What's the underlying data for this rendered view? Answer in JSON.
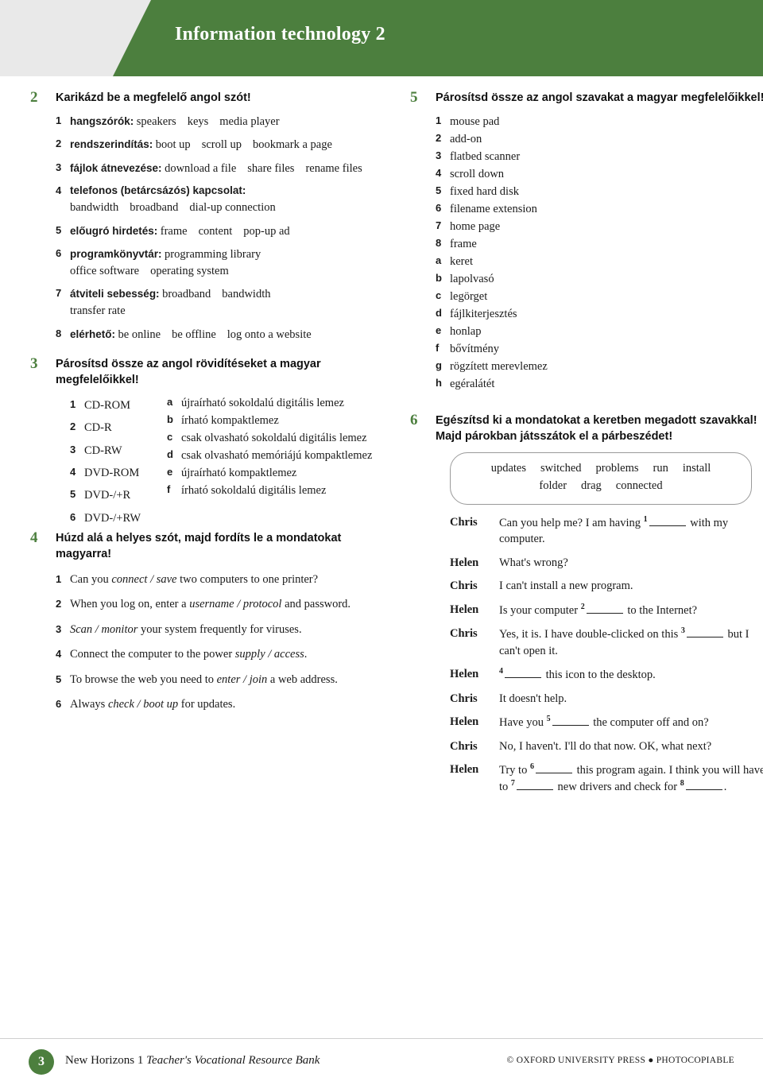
{
  "header": {
    "title": "Information technology 2"
  },
  "ex2": {
    "num": "2",
    "title": "Karikázd be a megfelelő angol szót!",
    "items": [
      {
        "n": "1",
        "lead": "hangszórók:",
        "options": [
          "speakers",
          "keys",
          "media player"
        ]
      },
      {
        "n": "2",
        "lead": "rendszerindítás:",
        "options": [
          "boot up",
          "scroll up",
          "bookmark a page"
        ]
      },
      {
        "n": "3",
        "lead": "fájlok átnevezése:",
        "options": [
          "download a file",
          "share files",
          "rename files"
        ]
      },
      {
        "n": "4",
        "lead": "telefonos (betárcsázós) kapcsolat:",
        "options": [
          "bandwidth",
          "broadband",
          "dial-up connection"
        ]
      },
      {
        "n": "5",
        "lead": "előugró hirdetés:",
        "options": [
          "frame",
          "content",
          "pop-up ad"
        ]
      },
      {
        "n": "6",
        "lead": "programkönyvtár:",
        "options": [
          "programming library",
          "office software",
          "operating system"
        ]
      },
      {
        "n": "7",
        "lead": "átviteli sebesség:",
        "options": [
          "broadband",
          "bandwidth",
          "transfer rate"
        ]
      },
      {
        "n": "8",
        "lead": "elérhető:",
        "options": [
          "be online",
          "be offline",
          "log onto a website"
        ]
      }
    ]
  },
  "ex3": {
    "num": "3",
    "title": "Párosítsd össze az angol rövidítéseket a magyar megfelelőikkel!",
    "left": [
      {
        "k": "1",
        "t": "CD-ROM"
      },
      {
        "k": "2",
        "t": "CD-R"
      },
      {
        "k": "3",
        "t": "CD-RW"
      },
      {
        "k": "4",
        "t": "DVD-ROM"
      },
      {
        "k": "5",
        "t": "DVD-/+R"
      },
      {
        "k": "6",
        "t": "DVD-/+RW"
      }
    ],
    "right": [
      {
        "k": "a",
        "t": "újraírható sokoldalú digitális lemez"
      },
      {
        "k": "b",
        "t": "írható kompaktlemez"
      },
      {
        "k": "c",
        "t": "csak olvasható sokoldalú digitális lemez"
      },
      {
        "k": "d",
        "t": "csak olvasható memóriájú kompaktlemez"
      },
      {
        "k": "e",
        "t": "újraírható kompaktlemez"
      },
      {
        "k": "f",
        "t": "írható sokoldalú digitális lemez"
      }
    ]
  },
  "ex4": {
    "num": "4",
    "title": "Húzd alá a helyes szót, majd fordíts le a mondatokat magyarra!",
    "sentences": [
      {
        "n": "1",
        "pre": "Can you ",
        "it": "connect / save",
        "post": " two computers to one printer?"
      },
      {
        "n": "2",
        "pre": "When you log on, enter a ",
        "it": "username / protocol",
        "post": " and password."
      },
      {
        "n": "3",
        "pre": "",
        "it": "Scan / monitor",
        "post": " your system frequently for viruses."
      },
      {
        "n": "4",
        "pre": "Connect the computer to the power ",
        "it": "supply / access",
        "post": "."
      },
      {
        "n": "5",
        "pre": "To browse the web you need to ",
        "it": "enter / join",
        "post": " a web address."
      },
      {
        "n": "6",
        "pre": "Always ",
        "it": "check / boot up",
        "post": " for updates."
      }
    ]
  },
  "ex5": {
    "num": "5",
    "title": "Párosítsd össze az angol szavakat a magyar megfelelőikkel!",
    "left": [
      {
        "k": "1",
        "t": "mouse pad"
      },
      {
        "k": "2",
        "t": "add-on"
      },
      {
        "k": "3",
        "t": "flatbed scanner"
      },
      {
        "k": "4",
        "t": "scroll down"
      },
      {
        "k": "5",
        "t": "fixed hard disk"
      },
      {
        "k": "6",
        "t": "filename extension"
      },
      {
        "k": "7",
        "t": "home page"
      },
      {
        "k": "8",
        "t": "frame"
      }
    ],
    "right": [
      {
        "k": "a",
        "t": "keret"
      },
      {
        "k": "b",
        "t": "lapolvasó"
      },
      {
        "k": "c",
        "t": "legörget"
      },
      {
        "k": "d",
        "t": "fájlkiterjesztés"
      },
      {
        "k": "e",
        "t": "honlap"
      },
      {
        "k": "f",
        "t": "bővítmény"
      },
      {
        "k": "g",
        "t": "rögzített merevlemez"
      },
      {
        "k": "h",
        "t": "egéralátét"
      }
    ]
  },
  "ex6": {
    "num": "6",
    "title": "Egészítsd ki a mondatokat a keretben megadott szavakkal! Majd párokban játsszátok el a párbeszédet!",
    "wordbank_line1": [
      "updates",
      "switched",
      "problems",
      "run",
      "install"
    ],
    "wordbank_line2": [
      "folder",
      "drag",
      "connected"
    ],
    "dialogue": [
      {
        "who": "Chris",
        "parts": [
          "Can you help me? I am having ",
          "sup1",
          " with my computer."
        ]
      },
      {
        "who": "Helen",
        "parts": [
          "What's wrong?"
        ]
      },
      {
        "who": "Chris",
        "parts": [
          "I can't install a new program."
        ]
      },
      {
        "who": "Helen",
        "parts": [
          "Is your computer ",
          "sup2",
          " to the Internet?"
        ]
      },
      {
        "who": "Chris",
        "parts": [
          "Yes, it is. I have double-clicked on this ",
          "sup3",
          " but I can't open it."
        ]
      },
      {
        "who": "Helen",
        "parts": [
          "sup4",
          " this icon to the desktop."
        ]
      },
      {
        "who": "Chris",
        "parts": [
          "It doesn't help."
        ]
      },
      {
        "who": "Helen",
        "parts": [
          "Have you ",
          "sup5",
          " the computer off and on?"
        ]
      },
      {
        "who": "Chris",
        "parts": [
          "No, I haven't. I'll do that now. OK, what next?"
        ]
      },
      {
        "who": "Helen",
        "parts": [
          "Try to ",
          "sup6",
          " this program again. I think you will have to ",
          "sup7",
          " new drivers and check for ",
          "sup8",
          "."
        ]
      }
    ]
  },
  "footer": {
    "page_number": "3",
    "left_plain": "New Horizons 1 ",
    "left_italic": "Teacher's Vocational Resource Bank",
    "right": "© OXFORD UNIVERSITY PRESS ● PHOTOCOPIABLE"
  },
  "colors": {
    "accent": "#4c7f3e",
    "band": "#e9e9e9"
  }
}
